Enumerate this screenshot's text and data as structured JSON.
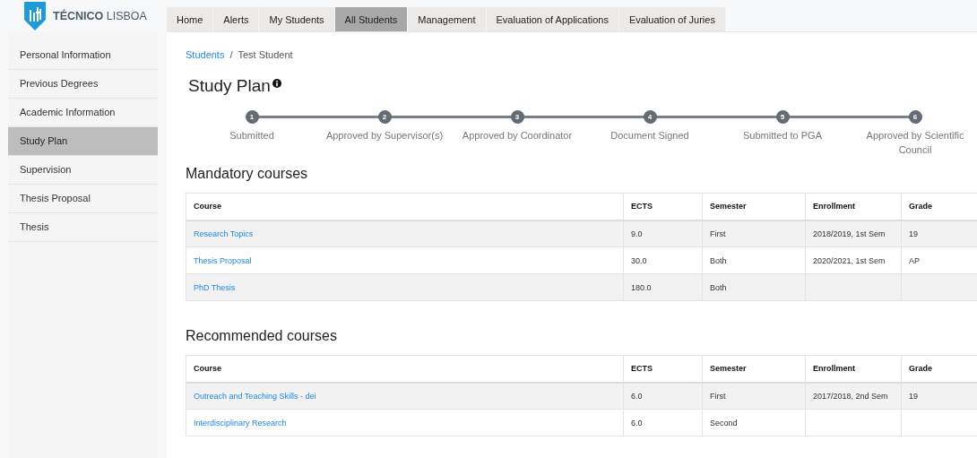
{
  "logo": {
    "text": "**TÉCNICO** LISBOA"
  },
  "nav_tabs": [
    {
      "label": "Home",
      "selected": false
    },
    {
      "label": "Alerts",
      "selected": false
    },
    {
      "label": "My Students",
      "selected": false
    },
    {
      "label": "All Students",
      "selected": true
    },
    {
      "label": "Management",
      "selected": false
    },
    {
      "label": "Evaluation of Applications",
      "selected": false
    },
    {
      "label": "Evaluation of Juries",
      "selected": false
    }
  ],
  "sidebar": {
    "items": [
      {
        "label": "Personal Information",
        "selected": false
      },
      {
        "label": "Previous Degrees",
        "selected": false
      },
      {
        "label": "Academic Information",
        "selected": false
      },
      {
        "label": "Study Plan",
        "selected": true
      },
      {
        "label": "Supervision",
        "selected": false
      },
      {
        "label": "Thesis Proposal",
        "selected": false
      },
      {
        "label": "Thesis",
        "selected": false
      }
    ]
  },
  "breadcrumb": {
    "link": "Students",
    "separator": "/",
    "current": "Test Student"
  },
  "title": "Study Plan",
  "steps": [
    {
      "number": "1",
      "label": "Submitted"
    },
    {
      "number": "2",
      "label": "Approved by Supervisor(s)"
    },
    {
      "number": "3",
      "label": "Approved by Coordinator"
    },
    {
      "number": "4",
      "label": "Document Signed"
    },
    {
      "number": "5",
      "label": "Submitted to PGA"
    },
    {
      "number": "6",
      "label": "Approved by Scientific Council"
    }
  ],
  "tables": [
    {
      "heading": "Mandatory courses",
      "columns": [
        "Course",
        "ECTS",
        "Semester",
        "Enrollment",
        "Grade"
      ],
      "rows": [
        [
          "Research Topics",
          "9.0",
          "First",
          "2018/2019, 1st Sem",
          "19"
        ],
        [
          "Thesis Proposal",
          "30.0",
          "Both",
          "2020/2021, 1st Sem",
          "AP"
        ],
        [
          "PhD Thesis",
          "180.0",
          "Both",
          "",
          ""
        ]
      ]
    },
    {
      "heading": "Recommended courses",
      "columns": [
        "Course",
        "ECTS",
        "Semester",
        "Enrollment",
        "Grade"
      ],
      "rows": [
        [
          "Outreach and Teaching Skills - dei",
          "6.0",
          "First",
          "2017/2018, 2nd Sem",
          "19"
        ],
        [
          "Interdisciplinary Research",
          "6.0",
          "Second",
          "",
          ""
        ]
      ]
    }
  ]
}
